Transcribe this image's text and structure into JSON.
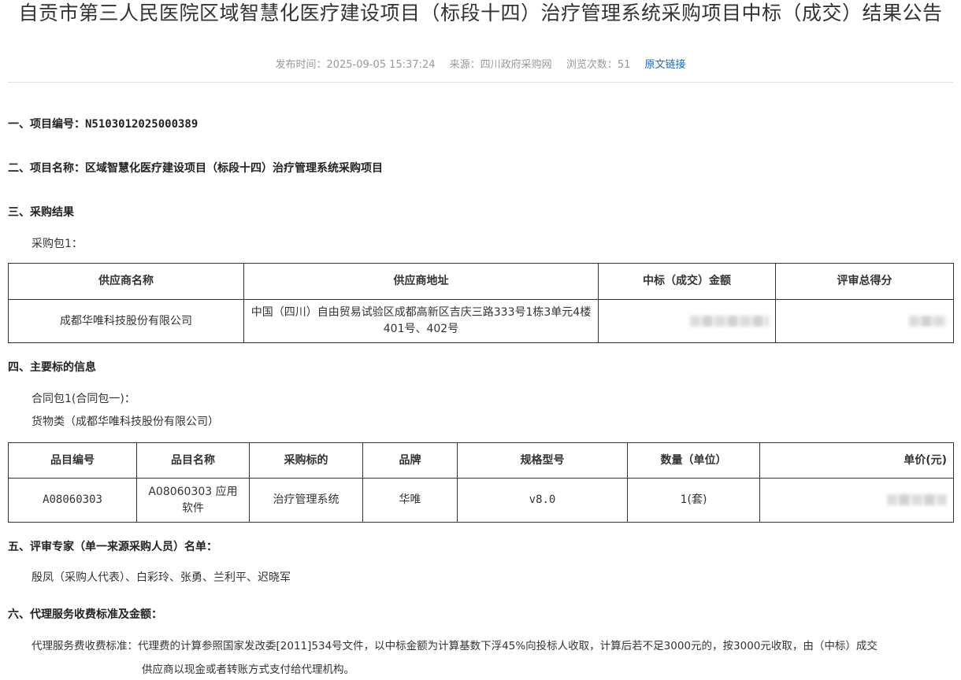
{
  "header": {
    "title": "自贡市第三人民医院区域智慧化医疗建设项目（标段十四）治疗管理系统采购项目中标（成交）结果公告",
    "publish_time": "发布时间：2025-09-05 15:37:24",
    "source": "来源：四川政府采购网",
    "views": "浏览次数：51",
    "original_link": "原文链接"
  },
  "section1": {
    "heading": "一、项目编号：N5103012025000389"
  },
  "section2": {
    "heading": "二、项目名称：区域智慧化医疗建设项目（标段十四）治疗管理系统采购项目"
  },
  "section3": {
    "heading": "三、采购结果",
    "package": "采购包1：",
    "table": {
      "headers": [
        "供应商名称",
        "供应商地址",
        "中标（成交）金额",
        "评审总得分"
      ],
      "row": {
        "supplier": "成都华唯科技股份有限公司",
        "address": "中国（四川）自由贸易试验区成都高新区吉庆三路333号1栋3单元4楼401号、402号"
      }
    }
  },
  "section4": {
    "heading": "四、主要标的信息",
    "contract_package": "合同包1(合同包一)：",
    "category": "货物类（成都华唯科技股份有限公司）",
    "table": {
      "headers": [
        "品目编号",
        "品目名称",
        "采购标的",
        "品牌",
        "规格型号",
        "数量（单位）",
        "单价(元)"
      ],
      "row": [
        "A08060303",
        "A08060303 应用软件",
        "治疗管理系统",
        "华唯",
        "v8.0",
        "1(套)"
      ]
    }
  },
  "section5": {
    "heading": "五、评审专家（单一来源采购人员）名单：",
    "names": "殷凤（采购人代表）、白彩玲、张勇、兰利平、迟晓军"
  },
  "section6": {
    "heading": "六、代理服务收费标准及金额：",
    "label": "代理服务费收费标准：",
    "text": "代理费的计算参照国家发改委[2011]534号文件，以中标金额为计算基数下浮45%向投标人收取，计算后若不足3000元的，按3000元收取，由（中标）成交",
    "text2": "供应商以现金或者转账方式支付给代理机构。"
  }
}
